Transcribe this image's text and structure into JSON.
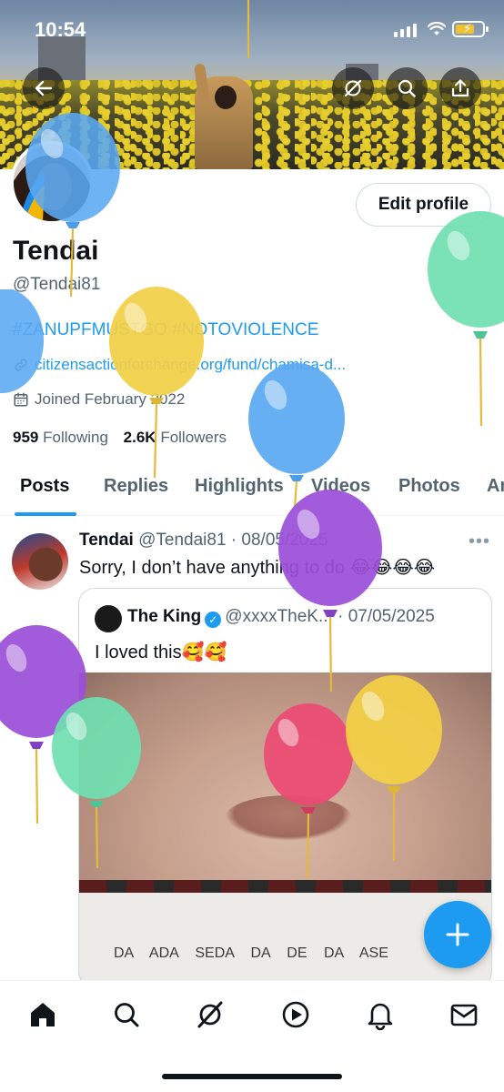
{
  "status_bar": {
    "time": "10:54"
  },
  "profile": {
    "name": "Tendai",
    "handle": "@Tendai81",
    "edit_button": "Edit profile",
    "bio": "#ZANUPFMUSTGO #NOTOVIOLENCE",
    "url": "citizensactionforchange.org/fund/chamisa-d...",
    "joined": "Joined February 2022",
    "following_count": "959",
    "following_label": "Following",
    "followers_count": "2.6K",
    "followers_label": "Followers"
  },
  "tabs": [
    "Posts",
    "Replies",
    "Highlights",
    "Videos",
    "Photos",
    "Ar"
  ],
  "post": {
    "author": "Tendai",
    "meta": "@Tendai81 · 08/05/2025",
    "text": "Sorry, I don’t have anything to do 😂😂😂😂",
    "quote": {
      "author": "The King",
      "meta": "@xxxxTheK... · 07/05/2025",
      "text": "I loved this🥰🥰",
      "media_text": "DA ADA SEDA DA DE DA ASE"
    }
  },
  "icons": {
    "back": "back-arrow-icon",
    "spaces": "grok-icon",
    "search": "search-icon",
    "share": "share-icon",
    "link": "link-icon",
    "calendar": "calendar-icon",
    "fab": "plus-icon",
    "nav": [
      "home-icon",
      "search-icon",
      "grok-icon",
      "video-icon",
      "bell-icon",
      "mail-icon"
    ]
  },
  "colors": {
    "accent": "#1d9bf0",
    "balloon_blue": "#5aa8f2",
    "balloon_yellow": "#f2cf45",
    "balloon_green": "#6fe0b0",
    "balloon_purple": "#9b4fd8",
    "balloon_pink": "#ec4a73"
  }
}
